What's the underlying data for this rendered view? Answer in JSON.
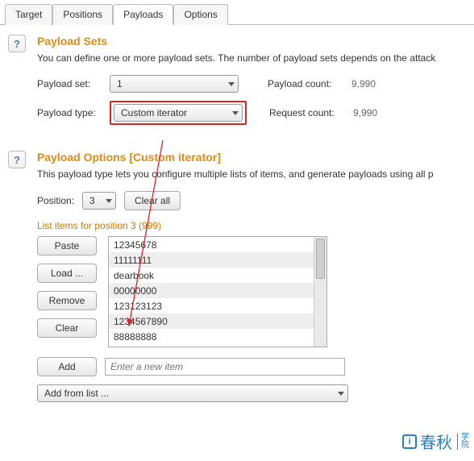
{
  "tabs": {
    "target": "Target",
    "positions": "Positions",
    "payloads": "Payloads",
    "options": "Options",
    "active": "payloads"
  },
  "payload_sets": {
    "title": "Payload Sets",
    "description": "You can define one or more payload sets. The number of payload sets depends on the attack",
    "set_label": "Payload set:",
    "set_value": "1",
    "type_label": "Payload type:",
    "type_value": "Custom iterator",
    "payload_count_label": "Payload count:",
    "payload_count_value": "9,990",
    "request_count_label": "Request count:",
    "request_count_value": "9,990"
  },
  "payload_options": {
    "title": "Payload Options [Custom iterator]",
    "description": "This payload type lets you configure multiple lists of items, and generate payloads using all p",
    "position_label": "Position:",
    "position_value": "3",
    "clear_all": "Clear all",
    "list_heading": "List items for position 3 (999)",
    "buttons": {
      "paste": "Paste",
      "load": "Load ...",
      "remove": "Remove",
      "clear": "Clear",
      "add": "Add"
    },
    "items": [
      "12345678",
      "11111111",
      "dearbook",
      "00000000",
      "123123123",
      "1234567890",
      "88888888"
    ],
    "new_item_placeholder": "Enter a new item",
    "add_from_list": "Add from list ..."
  },
  "help_glyph": "?",
  "watermark": {
    "brand": "春秋",
    "badge": "i",
    "sub1": "学",
    "sub2": "院"
  }
}
